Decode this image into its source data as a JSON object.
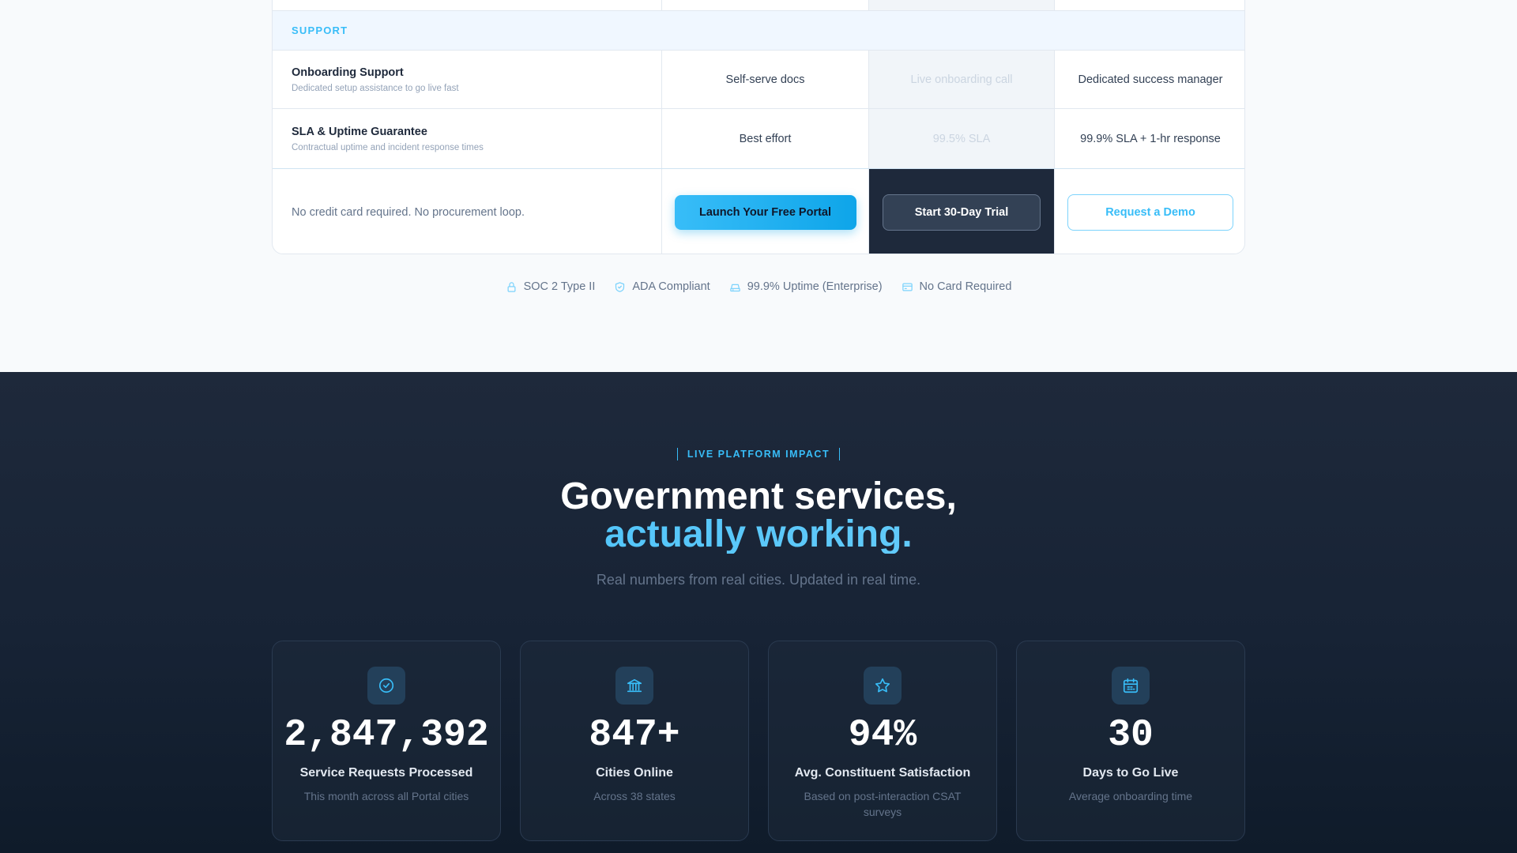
{
  "comparison": {
    "section_label": "SUPPORT",
    "features": [
      {
        "title": "Onboarding Support",
        "description": "Dedicated setup assistance to go live fast",
        "values": [
          "Self-serve docs",
          "Live onboarding call",
          "Dedicated success manager"
        ]
      },
      {
        "title": "SLA & Uptime Guarantee",
        "description": "Contractual uptime and incident response times",
        "values": [
          "Best effort",
          "99.5% SLA",
          "99.9% SLA + 1-hr response"
        ]
      }
    ],
    "cta": {
      "note": "No credit card required. No procurement loop.",
      "primary_label": "Launch Your Free Portal",
      "trial_label": "Start 30-Day Trial",
      "demo_label": "Request a Demo"
    }
  },
  "trust_badges": [
    {
      "icon": "lock-icon",
      "label": "SOC 2 Type II"
    },
    {
      "icon": "shield-icon",
      "label": "ADA Compliant"
    },
    {
      "icon": "server-icon",
      "label": "99.9% Uptime (Enterprise)"
    },
    {
      "icon": "credit-card-icon",
      "label": "No Card Required"
    }
  ],
  "impact": {
    "eyebrow": "LIVE PLATFORM IMPACT",
    "headline_line1": "Government services,",
    "headline_line2": "actually working.",
    "subhead": "Real numbers from real cities. Updated in real time.",
    "stats": [
      {
        "icon": "check-circle-icon",
        "value": "2,847,392",
        "label": "Service Requests Processed",
        "description": "This month across all Portal cities"
      },
      {
        "icon": "building-icon",
        "value": "847+",
        "label": "Cities Online",
        "description": "Across 38 states"
      },
      {
        "icon": "star-icon",
        "value": "94%",
        "label": "Avg. Constituent Satisfaction",
        "description": "Based on post-interaction CSAT surveys"
      },
      {
        "icon": "calendar-icon",
        "value": "30",
        "label": "Days to Go Live",
        "description": "Average onboarding time"
      }
    ]
  },
  "colors": {
    "accent": "#38bdf8",
    "dark_bg": "#1e293b",
    "light_bg": "#f8fafc"
  }
}
